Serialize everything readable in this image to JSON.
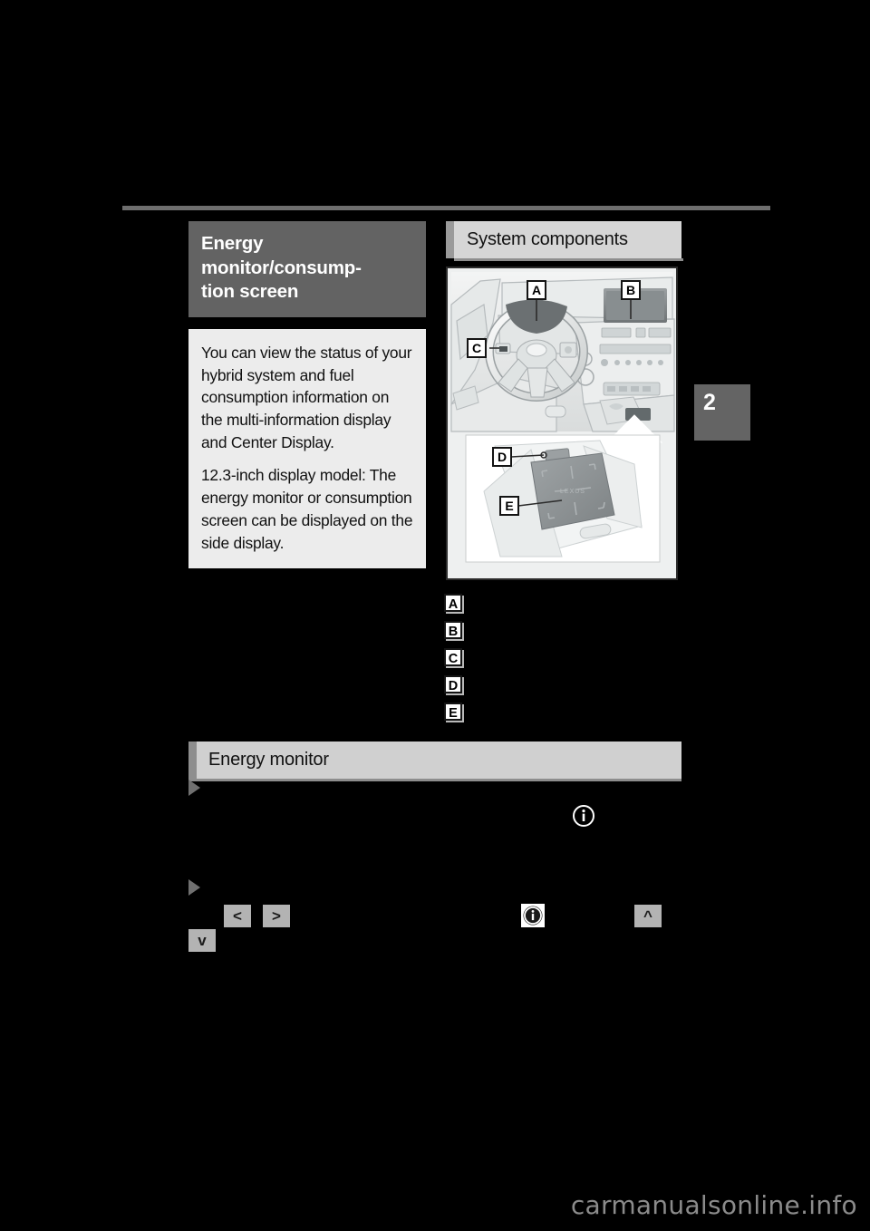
{
  "page": {
    "chapter_tab": "2",
    "watermark": "carmanualsonline.info"
  },
  "left_column": {
    "title": "Energy monitor/consump-\ntion screen",
    "intro_paragraph_1": "You can view the status of your hybrid system and fuel consumption information on the multi-information display and Center Display.",
    "intro_paragraph_2": "12.3-inch display model: The energy monitor or consumption screen can be displayed on the side display."
  },
  "right_column": {
    "title": "System components",
    "illustration": {
      "caption_labels": [
        "A",
        "B",
        "C",
        "D",
        "E"
      ],
      "touchpad_brand": "LEXUS"
    }
  },
  "callouts": [
    {
      "badge": "A",
      "text": ""
    },
    {
      "badge": "B",
      "text": ""
    },
    {
      "badge": "C",
      "text": ""
    },
    {
      "badge": "D",
      "text": ""
    },
    {
      "badge": "E",
      "text": ""
    }
  ],
  "energy_monitor_section": {
    "title": "Energy monitor",
    "bullet_1": "",
    "bullet_2": "",
    "controls": {
      "left_arrow": "<",
      "right_arrow": ">",
      "up_arrow": "^",
      "down_arrow": "v",
      "info_icon": "info-icon"
    }
  }
}
